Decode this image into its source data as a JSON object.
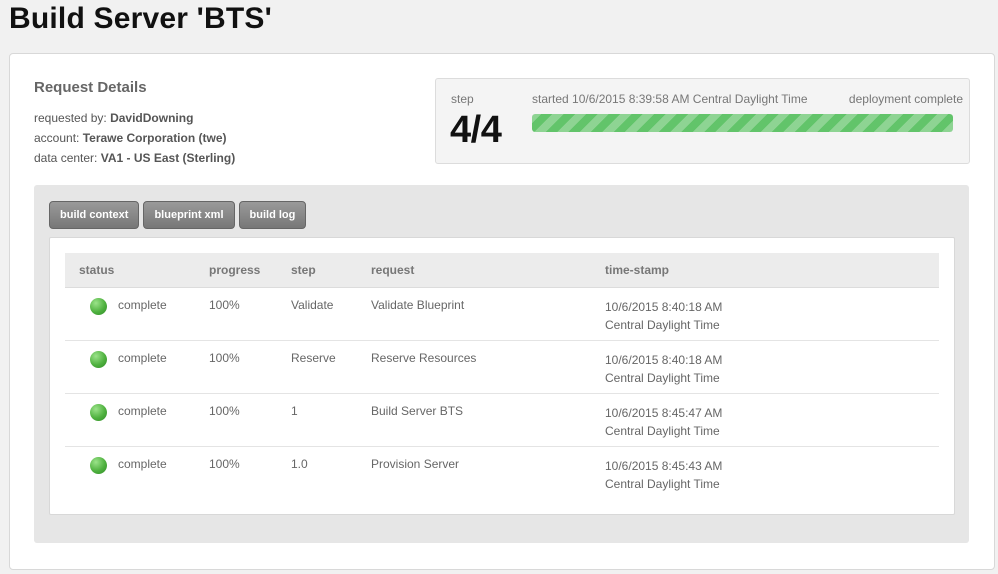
{
  "page_title": "Build Server 'BTS'",
  "request_details": {
    "heading": "Request Details",
    "requested_by_label": "requested by:",
    "requested_by": "DavidDowning",
    "account_label": "account:",
    "account": "Terawe Corporation (twe)",
    "data_center_label": "data center:",
    "data_center": "VA1 - US East (Sterling)"
  },
  "status": {
    "step_label": "step",
    "step_value": "4/4",
    "started": "started 10/6/2015 8:39:58 AM Central Daylight Time",
    "deployment_status": "deployment complete",
    "progress_percent": 100,
    "progress_color": "#62c46a"
  },
  "tabs": [
    {
      "label": "build context"
    },
    {
      "label": "blueprint xml"
    },
    {
      "label": "build log"
    }
  ],
  "table": {
    "headers": {
      "status": "status",
      "progress": "progress",
      "step": "step",
      "request": "request",
      "timestamp": "time-stamp"
    },
    "rows": [
      {
        "status": "complete",
        "progress": "100%",
        "step": "Validate",
        "request": "Validate Blueprint",
        "time": "10/6/2015 8:40:18 AM",
        "tz": "Central Daylight Time"
      },
      {
        "status": "complete",
        "progress": "100%",
        "step": "Reserve",
        "request": "Reserve Resources",
        "time": "10/6/2015 8:40:18 AM",
        "tz": "Central Daylight Time"
      },
      {
        "status": "complete",
        "progress": "100%",
        "step": "1",
        "request": "Build Server BTS",
        "time": "10/6/2015 8:45:47 AM",
        "tz": "Central Daylight Time"
      },
      {
        "status": "complete",
        "progress": "100%",
        "step": "1.0",
        "request": "Provision Server",
        "time": "10/6/2015 8:45:43 AM",
        "tz": "Central Daylight Time"
      }
    ]
  }
}
